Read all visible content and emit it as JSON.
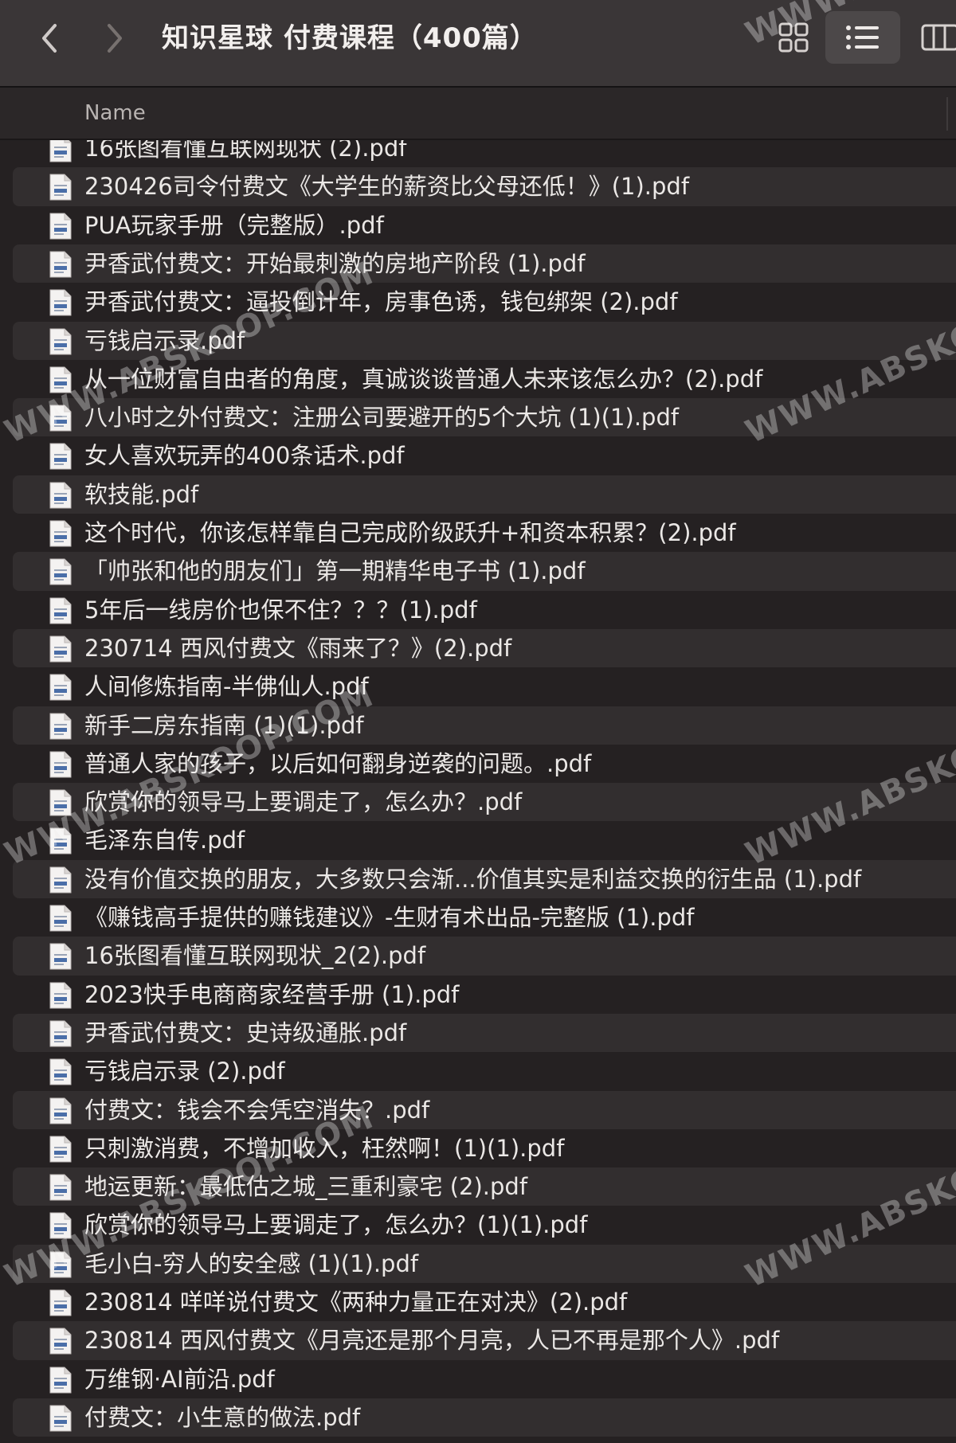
{
  "window": {
    "title": "知识星球 付费课程（400篇）",
    "back_icon": "chevron-left-icon",
    "forward_icon": "chevron-right-icon",
    "view_modes": [
      {
        "icon": "grid-view-icon",
        "active": false
      },
      {
        "icon": "list-view-icon",
        "active": true
      },
      {
        "icon": "column-view-icon",
        "active": false
      }
    ]
  },
  "header": {
    "name_label": "Name"
  },
  "files": [
    "16张图看懂互联网现状 (2).pdf",
    "230426司令付费文《大学生的薪资比父母还低！》(1).pdf",
    "PUA玩家手册（完整版）.pdf",
    "尹香武付费文：开始最刺激的房地产阶段 (1).pdf",
    "尹香武付费文：逼投倒计年，房事色诱，钱包绑架 (2).pdf",
    "亏钱启示录.pdf",
    "从一位财富自由者的角度，真诚谈谈普通人未来该怎么办？(2).pdf",
    "八小时之外付费文：注册公司要避开的5个大坑 (1)(1).pdf",
    "女人喜欢玩弄的400条话术.pdf",
    "软技能.pdf",
    "这个时代，你该怎样靠自己完成阶级跃升+和资本积累？(2).pdf",
    "「帅张和他的朋友们」第一期精华电子书 (1).pdf",
    "5年后一线房价也保不住？？？(1).pdf",
    "230714 西风付费文《雨来了？》(2).pdf",
    "人间修炼指南-半佛仙人.pdf",
    "新手二房东指南 (1)(1).pdf",
    "普通人家的孩子，以后如何翻身逆袭的问题。.pdf",
    "欣赏你的领导马上要调走了，怎么办？.pdf",
    "毛泽东自传.pdf",
    "没有价值交换的朋友，大多数只会渐...价值其实是利益交换的衍生品 (1).pdf",
    "《赚钱高手提供的赚钱建议》-生财有术出品-完整版 (1).pdf",
    "16张图看懂互联网现状_2(2).pdf",
    "2023快手电商商家经营手册 (1).pdf",
    "尹香武付费文：史诗级通胀.pdf",
    "亏钱启示录 (2).pdf",
    "付费文：钱会不会凭空消失？.pdf",
    "只刺激消费，不增加收入，枉然啊！(1)(1).pdf",
    "地运更新：最低估之城_三重利豪宅 (2).pdf",
    "欣赏你的领导马上要调走了，怎么办？(1)(1).pdf",
    "毛小白-穷人的安全感 (1)(1).pdf",
    "230814 咩咩说付费文《两种力量正在对决》(2).pdf",
    "230814 西风付费文《月亮还是那个月亮，人已不再是那个人》.pdf",
    "万维钢·AI前沿.pdf",
    "付费文：小生意的做法.pdf"
  ],
  "file_icon": "pdf-document-icon",
  "watermark_text": "WWW.ABSKOOP.COM",
  "colors": {
    "background": "#252122",
    "row_alt": "#322e2f",
    "toolbar": "#3a3637",
    "text": "#ebe8e6"
  }
}
